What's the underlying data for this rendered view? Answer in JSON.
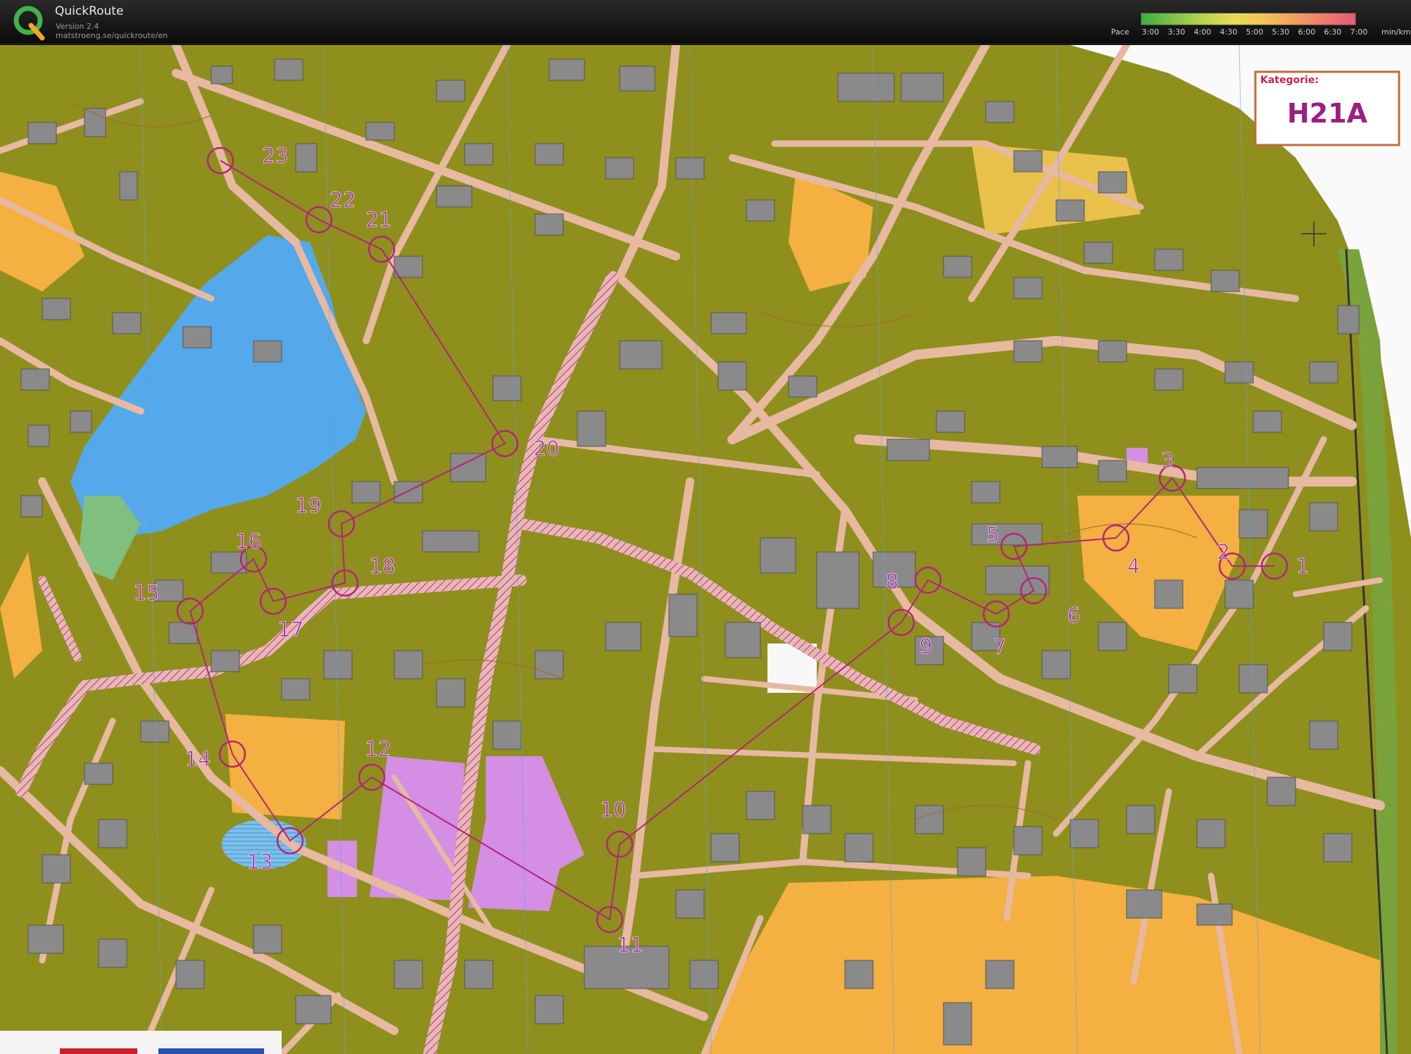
{
  "app": {
    "name": "QuickRoute",
    "version": "Version 2.4",
    "url": "matstroeng.se/quickroute/en"
  },
  "pace_legend": {
    "label": "Pace",
    "ticks": [
      "3:00",
      "3:30",
      "4:00",
      "4:30",
      "5:00",
      "5:30",
      "6:00",
      "6:30",
      "7:00"
    ],
    "unit": "min/km",
    "colors": [
      "#3fae3f",
      "#7cc04a",
      "#b9d14f",
      "#e6dc57",
      "#f2c45a",
      "#f0a060",
      "#ec7c6c",
      "#e55a75"
    ]
  },
  "map": {
    "category_label": "Kategorie:",
    "category_value": "H21A",
    "colors": {
      "forest": "#8f8f1d",
      "road": "#e7b9a1",
      "building": "#8a8a8a",
      "water": "#55a8ea",
      "open": "#f4b040",
      "overprint": "#b3247a",
      "paved": "#e6c2b6",
      "sport": "#d48ee3"
    },
    "controls": [
      {
        "number": "1"
      },
      {
        "number": "2"
      },
      {
        "number": "3"
      },
      {
        "number": "4"
      },
      {
        "number": "5"
      },
      {
        "number": "6"
      },
      {
        "number": "7"
      },
      {
        "number": "8"
      },
      {
        "number": "9"
      },
      {
        "number": "10"
      },
      {
        "number": "11"
      },
      {
        "number": "12"
      },
      {
        "number": "13"
      },
      {
        "number": "14"
      },
      {
        "number": "15"
      },
      {
        "number": "16"
      },
      {
        "number": "17"
      },
      {
        "number": "18"
      },
      {
        "number": "19"
      },
      {
        "number": "20"
      },
      {
        "number": "21"
      },
      {
        "number": "22"
      },
      {
        "number": "23"
      }
    ]
  }
}
